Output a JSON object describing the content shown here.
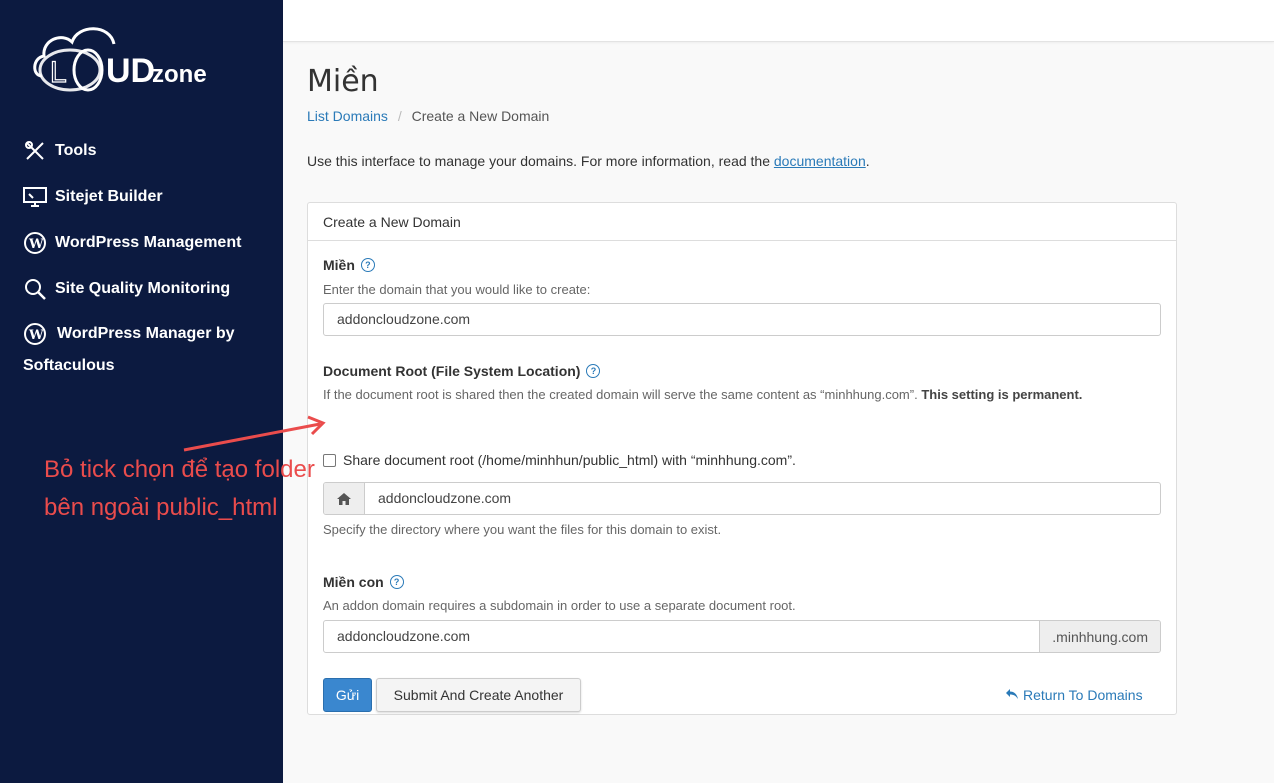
{
  "sidebar": {
    "logo": {
      "word": "LOUD",
      "suffix": "zone",
      "alt": "CLOUDzone"
    },
    "items": [
      {
        "label": "Tools",
        "icon": "tools-icon"
      },
      {
        "label": "Sitejet Builder",
        "icon": "monitor-icon"
      },
      {
        "label": "WordPress Management",
        "icon": "wordpress-icon"
      },
      {
        "label": "Site Quality Monitoring",
        "icon": "search-icon"
      },
      {
        "label_line1": "WordPress Manager by",
        "label_line2": "Softaculous",
        "icon": "wordpress-icon"
      }
    ]
  },
  "page": {
    "title": "Miền",
    "breadcrumb": {
      "parent": "List Domains",
      "separator": "/",
      "current": "Create a New Domain"
    },
    "intro_text": "Use this interface to manage your domains. For more information, read the ",
    "intro_link": "documentation",
    "intro_end": "."
  },
  "panel": {
    "title": "Create a New Domain",
    "domain": {
      "label": "Miền",
      "hint": "Enter the domain that you would like to create:",
      "value": "addoncloudzone.com"
    },
    "docroot": {
      "label": "Document Root (File System Location)",
      "hint": "If the document root is shared then the created domain will serve the same content as “minhhung.com”.",
      "hint_bold": "This setting is permanent.",
      "checkbox_label": "Share document root (/home/minhhun/public_html) with “minhhung.com”.",
      "checked": false,
      "value": "addoncloudzone.com",
      "help": "Specify the directory where you want the files for this domain to exist."
    },
    "subdomain": {
      "label": "Miền con",
      "hint": "An addon domain requires a subdomain in order to use a separate document root.",
      "value": "addoncloudzone.com",
      "suffix": ".minhhung.com"
    },
    "buttons": {
      "submit": "Gửi",
      "submit_another": "Submit And Create Another",
      "return": "Return To Domains"
    }
  },
  "annotation": {
    "line1": "Bỏ tick chọn để tạo folder",
    "line2": "bên ngoài public_html",
    "color": "#ea4c4c"
  },
  "colors": {
    "sidebar": "#0c1a40",
    "link": "#2a7ab8",
    "primary": "#3a87cf"
  }
}
